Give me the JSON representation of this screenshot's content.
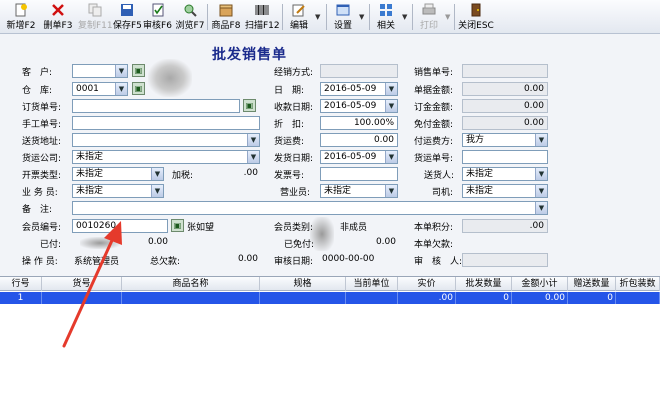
{
  "toolbar": {
    "new": "新增F2",
    "delete": "删单F3",
    "copy": "复制F11",
    "save": "保存F5",
    "audit": "审核F6",
    "browse": "浏览F7",
    "product": "商品F8",
    "scan": "扫描F12",
    "edit": "编辑",
    "settings": "设置",
    "related": "相关",
    "print": "打印",
    "close": "关闭ESC"
  },
  "form": {
    "title": "批发销售单",
    "customer_label": "客　户:",
    "warehouse_label": "仓　库:",
    "warehouse_value": "0001",
    "order_no_label": "订货单号:",
    "manual_no_label": "手工单号:",
    "ship_addr_label": "送货地址:",
    "freight_co_label": "货运公司:",
    "freight_co_value": "未指定",
    "invoice_type_label": "开票类型:",
    "tax_label": "加税:",
    "tax_value": ".00",
    "salesman_label": "业 务 员:",
    "salesman_value": "未指定",
    "invoice_type_value": "未指定",
    "remark_label": "备　注:",
    "member_no_label": "会员编号:",
    "member_no_value": "0010260",
    "member_name": "张如望",
    "paid_label": "已付:",
    "paid_value": "0.00",
    "operator_label": "操 作 员:",
    "operator_value": "系统管理员",
    "total_debt_label": "总欠款:",
    "total_debt_value": "0.00",
    "dealer_mode_label": "经销方式:",
    "date_label": "日　期:",
    "date_value": "2016-05-09",
    "collect_date_label": "收款日期:",
    "collect_date_value": "2016-05-09",
    "discount_label": "折　扣:",
    "discount_value": "100.00%",
    "freight_label": "货运费:",
    "freight_value": "0.00",
    "ship_date_label": "发货日期:",
    "ship_date_value": "2016-05-09",
    "invoice_no_label": "发票号:",
    "business_label": "营业员:",
    "business_value": "未指定",
    "member_type_label": "会员类别:",
    "member_type_value": "非成员",
    "exempt_label": "已免付:",
    "exempt_value": "0.00",
    "audit_date_label": "审核日期:",
    "audit_date_value": "0000-00-00",
    "sale_no_label": "销售单号:",
    "bill_amount_label": "单据金额:",
    "bill_amount_value": "0.00",
    "deposit_label": "订金金额:",
    "deposit_value": "0.00",
    "free_label": "免付金额:",
    "free_value": "0.00",
    "freight_payer_label": "付运费方:",
    "freight_payer_value": "我方",
    "freight_no_label": "货运单号:",
    "delivery_label": "送货人:",
    "delivery_value": "未指定",
    "driver_label": "司机:",
    "driver_value": "未指定",
    "points_label": "本单积分:",
    "points_value": ".00",
    "bill_debt_label": "本单欠款:",
    "reviewer_label": "审　核　人:"
  },
  "grid": {
    "columns": [
      "行号",
      "货号",
      "商品名称",
      "规格",
      "当前单位",
      "实价",
      "批发数量",
      "金额小计",
      "赠送数量",
      "折包装数"
    ],
    "rows": [
      {
        "line": "1",
        "code": "",
        "name": "",
        "spec": "",
        "unit": "",
        "price": ".00",
        "qty": "0",
        "subtotal": "0.00",
        "gift": "0",
        "pack": ""
      }
    ]
  },
  "colors": {
    "accent": "#2555e8",
    "title": "#1a2a8c",
    "arrow": "#e53a2c"
  }
}
